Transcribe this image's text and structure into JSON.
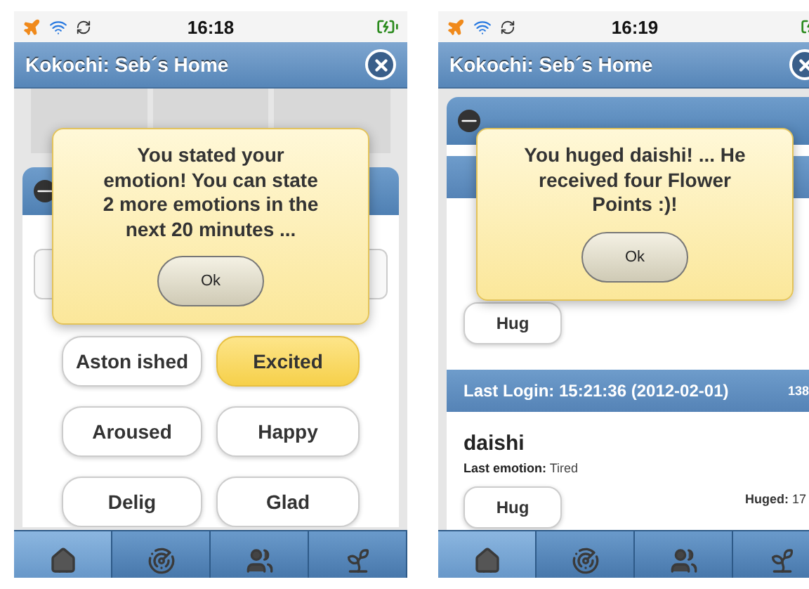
{
  "screens": [
    {
      "kind": "emotions",
      "status_bar": {
        "time": "16:18"
      },
      "title": "Kokochi: Seb´s Home",
      "emotions": [
        {
          "label": "Aston ished",
          "selected": false
        },
        {
          "label": "Excited",
          "selected": true
        },
        {
          "label": "Aroused",
          "selected": false
        },
        {
          "label": "Happy",
          "selected": false
        },
        {
          "label": "Delig",
          "selected": false
        },
        {
          "label": "Glad",
          "selected": false
        }
      ],
      "dialog": {
        "message": "You stated your emotion! You can state 2 more emotions in the next 20 minutes ...",
        "button": "Ok"
      },
      "tabs": [
        {
          "kind": "home",
          "selected": true
        },
        {
          "kind": "radar",
          "selected": false
        },
        {
          "kind": "group",
          "selected": false
        },
        {
          "kind": "plant",
          "selected": false
        }
      ]
    },
    {
      "kind": "players",
      "status_bar": {
        "time": "16:19"
      },
      "title": "Kokochi: Seb´s Home",
      "players": [
        {
          "hug": "Hug"
        },
        {
          "login": "Last Login: 15:21:36 (2012-02-01)",
          "count": "138",
          "name": "daishi",
          "emotion": "**Last emotion:** Tired",
          "huged": "**Huged:** 17",
          "hug": "Hug"
        }
      ],
      "dialog": {
        "message": "You huged daishi! ... He received four Flower Points :)!",
        "button": "Ok"
      },
      "tabs": [
        {
          "kind": "home",
          "selected": true
        },
        {
          "kind": "radar",
          "selected": false
        },
        {
          "kind": "group",
          "selected": false
        },
        {
          "kind": "plant",
          "selected": false
        }
      ]
    }
  ]
}
